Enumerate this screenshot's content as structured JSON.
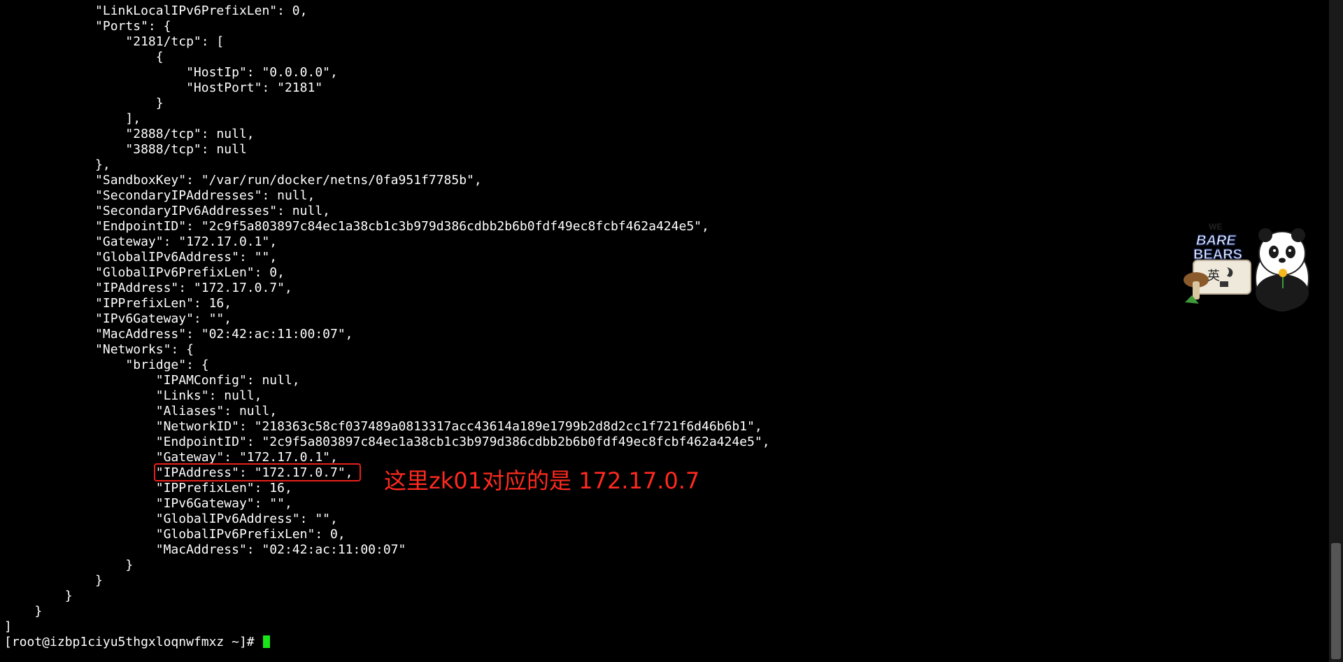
{
  "terminal": {
    "lines": [
      "            \"LinkLocalIPv6PrefixLen\": 0,",
      "            \"Ports\": {",
      "                \"2181/tcp\": [",
      "                    {",
      "                        \"HostIp\": \"0.0.0.0\",",
      "                        \"HostPort\": \"2181\"",
      "                    }",
      "                ],",
      "                \"2888/tcp\": null,",
      "                \"3888/tcp\": null",
      "            },",
      "            \"SandboxKey\": \"/var/run/docker/netns/0fa951f7785b\",",
      "            \"SecondaryIPAddresses\": null,",
      "            \"SecondaryIPv6Addresses\": null,",
      "            \"EndpointID\": \"2c9f5a803897c84ec1a38cb1c3b979d386cdbb2b6b0fdf49ec8fcbf462a424e5\",",
      "            \"Gateway\": \"172.17.0.1\",",
      "            \"GlobalIPv6Address\": \"\",",
      "            \"GlobalIPv6PrefixLen\": 0,",
      "            \"IPAddress\": \"172.17.0.7\",",
      "            \"IPPrefixLen\": 16,",
      "            \"IPv6Gateway\": \"\",",
      "            \"MacAddress\": \"02:42:ac:11:00:07\",",
      "            \"Networks\": {",
      "                \"bridge\": {",
      "                    \"IPAMConfig\": null,",
      "                    \"Links\": null,",
      "                    \"Aliases\": null,",
      "                    \"NetworkID\": \"218363c58cf037489a0813317acc43614a189e1799b2d8d2cc1f721f6d46b6b1\",",
      "                    \"EndpointID\": \"2c9f5a803897c84ec1a38cb1c3b979d386cdbb2b6b0fdf49ec8fcbf462a424e5\",",
      "                    \"Gateway\": \"172.17.0.1\",",
      "                    \"IPAddress\": \"172.17.0.7\",",
      "                    \"IPPrefixLen\": 16,",
      "                    \"IPv6Gateway\": \"\",",
      "                    \"GlobalIPv6Address\": \"\",",
      "                    \"GlobalIPv6PrefixLen\": 0,",
      "                    \"MacAddress\": \"02:42:ac:11:00:07\"",
      "                }",
      "            }",
      "        }",
      "    }",
      "]"
    ],
    "prompt": "[root@izbp1ciyu5thgxloqnwfmxz ~]# "
  },
  "annotation": {
    "text": "这里zk01对应的是 172.17.0.7"
  },
  "ime_widget": {
    "brand_top": "WE",
    "brand_mid": "BARE",
    "brand_bottom": "BEARS",
    "mode_label": "英",
    "icon": "panda-bear-icon"
  },
  "colors": {
    "background": "#000000",
    "text": "#ffffff",
    "cursor": "#19e619",
    "annotation": "#ff2a1f"
  }
}
